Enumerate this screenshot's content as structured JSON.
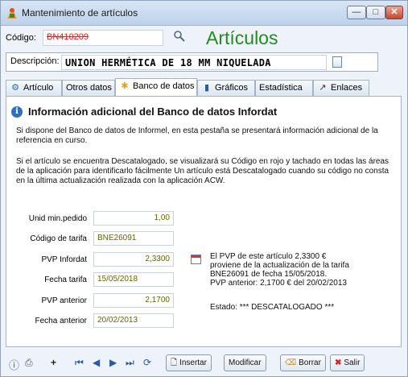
{
  "window": {
    "title": "Mantenimiento de artículos",
    "min_label": "—",
    "max_label": "□",
    "close_label": "✕"
  },
  "header": {
    "codigo_label": "Código:",
    "codigo_value": "BN410209",
    "big_title": "Artículos",
    "descripcion_label": "Descripción:",
    "descripcion_value": "UNION HERMÉTICA DE 18 MM NIQUELADA"
  },
  "tabs": [
    {
      "label": "Artículo",
      "icon": "article-icon"
    },
    {
      "label": "Otros datos",
      "icon": ""
    },
    {
      "label": "Banco de datos",
      "icon": "database-icon",
      "active": true
    },
    {
      "label": "Gráficos",
      "icon": "chart-icon"
    },
    {
      "label": "Estadística",
      "icon": ""
    },
    {
      "label": "Enlaces",
      "icon": "link-icon"
    }
  ],
  "panel": {
    "heading": "Información adicional del Banco de datos Infordat",
    "para1": "Si dispone del Banco de datos de Informel, en esta pestaña se presentará información adicional de la referencia en curso.",
    "para2": "Si el artículo se encuentra Descatalogado, se visualizará su Código en rojo y tachado en todas las áreas de la aplicación para identificarlo fácilmente Un artículo está Descatalogado cuando su código no consta en la última actualización realizada con la aplicación ACW.",
    "fields": [
      {
        "label": "Unid min.pedido",
        "value": "1,00"
      },
      {
        "label": "Código de tarifa",
        "value": "BNE26091"
      },
      {
        "label": "PVP Infordat",
        "value": "2,3300"
      },
      {
        "label": "Fecha tarifa",
        "value": "15/05/2018"
      },
      {
        "label": "PVP anterior",
        "value": "2,1700"
      },
      {
        "label": "Fecha anterior",
        "value": "20/02/2013"
      }
    ],
    "pvp_line1": "El PVP de este artículo 2,3300 €",
    "pvp_line2": "proviene de la actualización de la tarifa",
    "pvp_line3": "BNE26091 de fecha 15/05/2018.",
    "pvp_line4": "PVP anterior: 2,1700 € del 20/02/2013",
    "estado": "Estado: *** DESCATALOGADO ***"
  },
  "toolbar": {
    "insertar": "Insertar",
    "modificar": "Modificar",
    "borrar": "Borrar",
    "salir": "Salir",
    "plus": "+"
  },
  "colors": {
    "title_green": "#258a25",
    "discontinued_red": "#d22",
    "value_olive": "#666600"
  }
}
